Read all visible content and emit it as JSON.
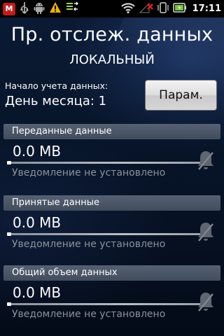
{
  "status_bar": {
    "time": "17:11",
    "left_icons": [
      "mcafee-icon",
      "usb-icon",
      "android-icon",
      "warning-icon",
      "data-sync-icon"
    ],
    "right_icons": [
      "wifi-icon",
      "signal-off-icon",
      "vibrate-icon",
      "battery-icon"
    ],
    "mcafee_letter": "M"
  },
  "header": {
    "title": "Пр. отслеж. данных",
    "subtitle": "ЛОКАЛЬНЫЙ"
  },
  "period": {
    "label": "Начало учета данных:",
    "value": "День месяца: 1"
  },
  "params_button": {
    "label": "Парам."
  },
  "sections": [
    {
      "header": "Переданные данные",
      "amount": "0.0 MB",
      "notice": "Уведомление не установлено"
    },
    {
      "header": "Принятые данные",
      "amount": "0.0 MB",
      "notice": "Уведомление не установлено"
    },
    {
      "header": "Общий объем данных",
      "amount": "0.0 MB",
      "notice": "Уведомление не установлено"
    }
  ],
  "colors": {
    "background": "#071428",
    "section_header": "#4a5568",
    "muted_text": "#8b929a",
    "mcafee_red": "#c21b1b"
  }
}
